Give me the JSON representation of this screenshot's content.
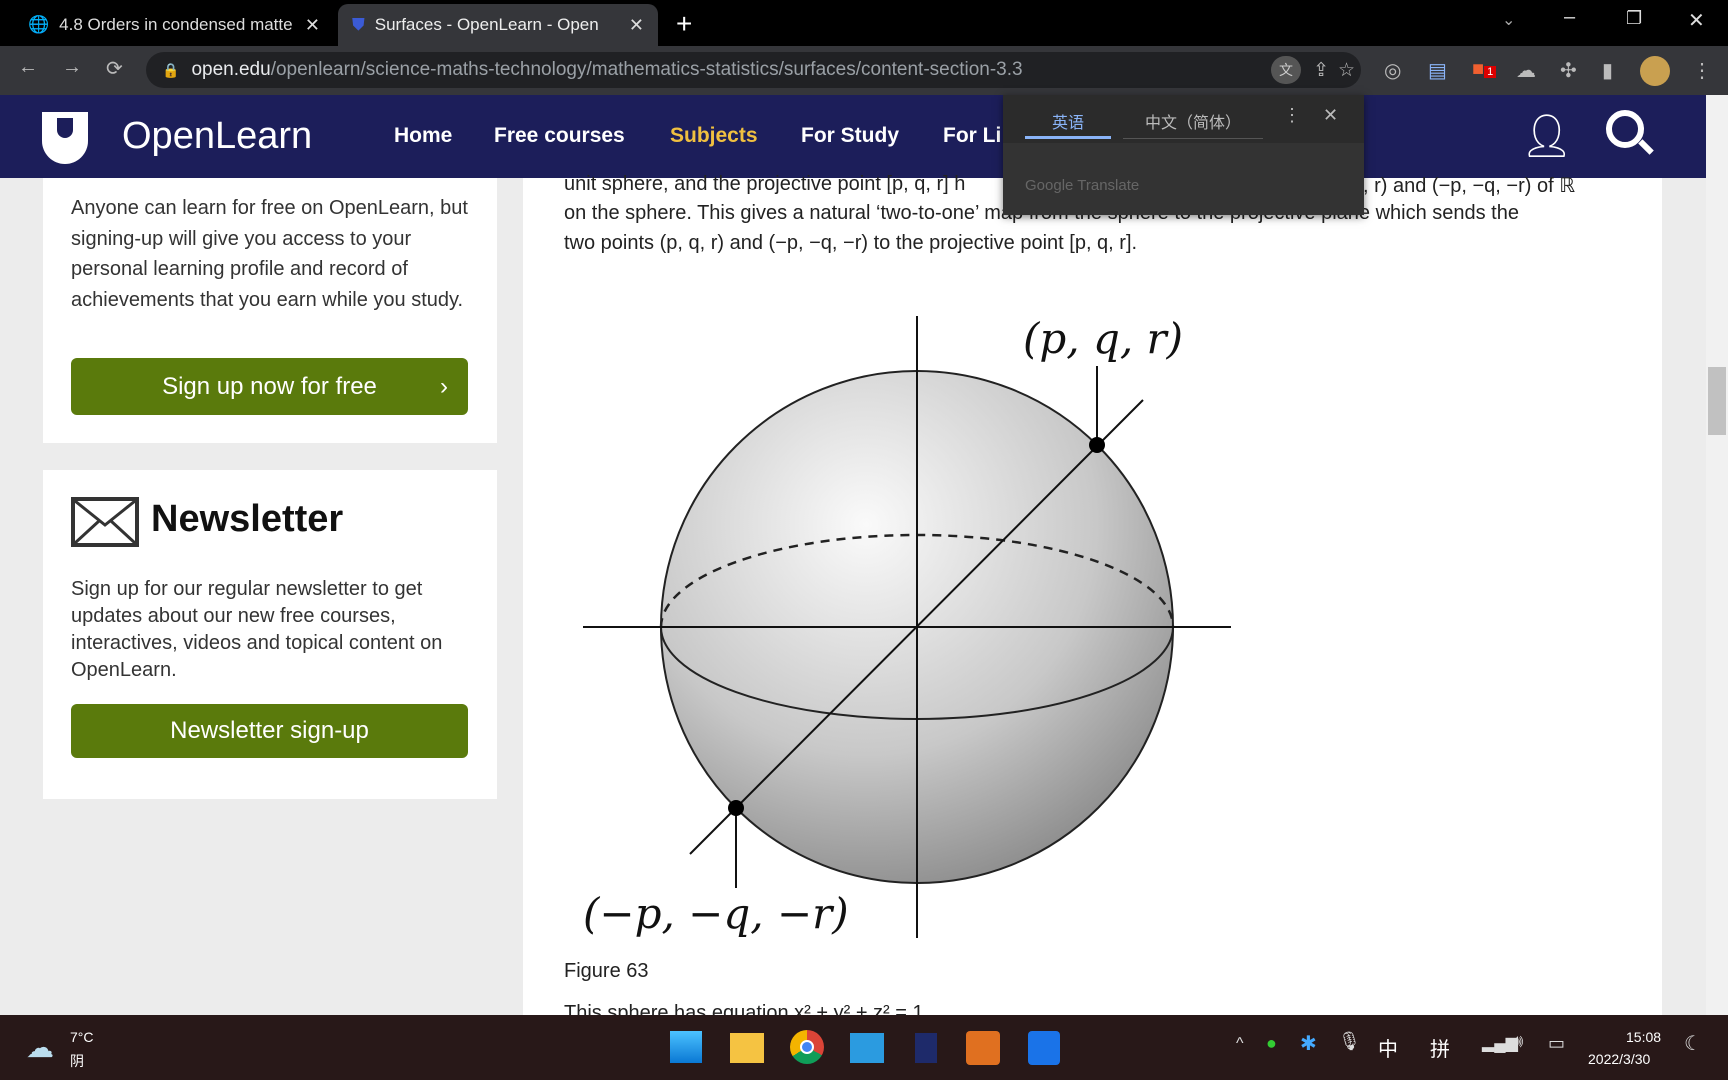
{
  "browser": {
    "tabs": [
      {
        "title": "4.8 Orders in condensed matte",
        "icon": "globe-icon"
      },
      {
        "title": "Surfaces - OpenLearn - Open",
        "icon": "openlearn-shield-icon"
      }
    ],
    "url_domain": "open.edu",
    "url_path": "/openlearn/science-maths-technology/mathematics-statistics/surfaces/content-section-3.3",
    "extension_badge": "1"
  },
  "site": {
    "logo": "OpenLearn",
    "nav": [
      "Home",
      "Free courses",
      "Subjects",
      "For Study",
      "For Li"
    ],
    "active_nav": "Subjects",
    "accent": "#f0c040",
    "nav_bg": "#1c1e5a"
  },
  "translate": {
    "tab_source": "英语",
    "tab_target": "中文（简体）",
    "brand": "Google Translate"
  },
  "sidebar": {
    "signup_text": "Anyone can learn for free on OpenLearn, but signing-up will give you access to your personal learning profile and record of achievements that you earn while you study.",
    "signup_button": "Sign up now for free",
    "newsletter_title": "Newsletter",
    "newsletter_text": "Sign up for our regular newsletter to get updates about our new free courses, interactives, videos and topical content on OpenLearn.",
    "newsletter_button": "Newsletter sign-up"
  },
  "article": {
    "line1a": "unit sphere, and the projective point [p, q, r] h",
    "line1b": ", r) and (−p, −q, −r) of ℝ",
    "line2": "on the sphere. This gives a natural ‘two-to-one’ map from the sphere to the projective plane which sends the",
    "line3": "two points (p, q, r) and (−p, −q, −r) to the projective point [p, q, r].",
    "figure_label_top": "(p, q, r)",
    "figure_label_bottom": "(−p, −q, −r)",
    "caption": "Figure 63",
    "next_line": "This sphere has equation x² + y² + z² = 1"
  },
  "taskbar": {
    "temp": "7°C",
    "weather": "阴",
    "ime1": "中",
    "ime2": "拼",
    "time": "15:08",
    "date": "2022/3/30"
  }
}
